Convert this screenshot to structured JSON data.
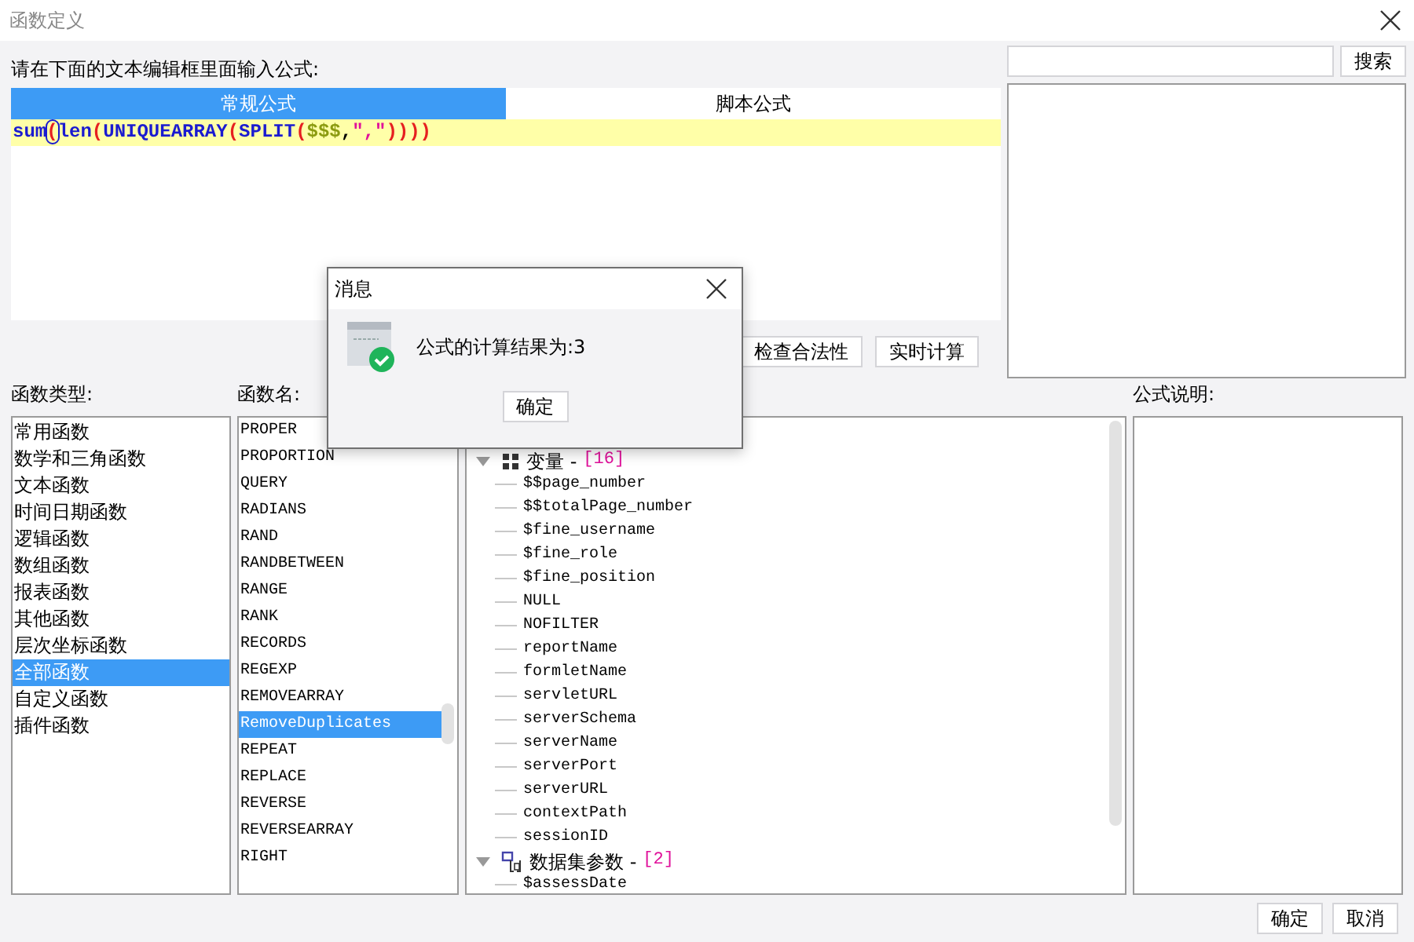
{
  "window": {
    "title": "函数定义"
  },
  "editor": {
    "prompt": "请在下面的文本编辑框里面输入公式:",
    "tabs": [
      {
        "label": "常规公式",
        "selected": true
      },
      {
        "label": "脚本公式",
        "selected": false
      }
    ],
    "formula": [
      {
        "text": "sum",
        "kind": "name"
      },
      {
        "text": "(",
        "kind": "paren",
        "matched": true
      },
      {
        "text": "len",
        "kind": "name"
      },
      {
        "text": "(",
        "kind": "paren",
        "matched": false
      },
      {
        "text": "UNIQUEARRAY",
        "kind": "name"
      },
      {
        "text": "(",
        "kind": "paren",
        "matched": false
      },
      {
        "text": "SPLIT",
        "kind": "name"
      },
      {
        "text": "(",
        "kind": "paren",
        "matched": false
      },
      {
        "text": "$$$",
        "kind": "param"
      },
      {
        "text": ",",
        "kind": "plain"
      },
      {
        "text": "\",\"",
        "kind": "string"
      },
      {
        "text": "))))",
        "kind": "paren",
        "matched": false
      }
    ],
    "buttons": [
      "检查合法性",
      "实时计算"
    ]
  },
  "search": {
    "button": "搜索"
  },
  "function_types": {
    "label": "函数类型:",
    "items": [
      {
        "label": "常用函数",
        "selected": false
      },
      {
        "label": "数学和三角函数",
        "selected": false
      },
      {
        "label": "文本函数",
        "selected": false
      },
      {
        "label": "时间日期函数",
        "selected": false
      },
      {
        "label": "逻辑函数",
        "selected": false
      },
      {
        "label": "数组函数",
        "selected": false
      },
      {
        "label": "报表函数",
        "selected": false
      },
      {
        "label": "其他函数",
        "selected": false
      },
      {
        "label": "层次坐标函数",
        "selected": false
      },
      {
        "label": "全部函数",
        "selected": true
      },
      {
        "label": "自定义函数",
        "selected": false
      },
      {
        "label": "插件函数",
        "selected": false
      }
    ]
  },
  "function_names": {
    "label": "函数名:",
    "items": [
      {
        "label": "PROPER",
        "selected": false
      },
      {
        "label": "PROPORTION",
        "selected": false
      },
      {
        "label": "QUERY",
        "selected": false
      },
      {
        "label": "RADIANS",
        "selected": false
      },
      {
        "label": "RAND",
        "selected": false
      },
      {
        "label": "RANDBETWEEN",
        "selected": false
      },
      {
        "label": "RANGE",
        "selected": false
      },
      {
        "label": "RANK",
        "selected": false
      },
      {
        "label": "RECORDS",
        "selected": false
      },
      {
        "label": "REGEXP",
        "selected": false
      },
      {
        "label": "REMOVEARRAY",
        "selected": false
      },
      {
        "label": "RemoveDuplicates",
        "selected": true
      },
      {
        "label": "REPEAT",
        "selected": false
      },
      {
        "label": "REPLACE",
        "selected": false
      },
      {
        "label": "REVERSE",
        "selected": false
      },
      {
        "label": "REVERSEARRAY",
        "selected": false
      },
      {
        "label": "RIGHT",
        "selected": false
      }
    ]
  },
  "parameter_tree": [
    {
      "label": "变量 -",
      "count": "[16]",
      "kind": "variables",
      "expanded": true,
      "children": [
        {
          "label": "$$page_number"
        },
        {
          "label": "$$totalPage_number"
        },
        {
          "label": "$fine_username"
        },
        {
          "label": "$fine_role"
        },
        {
          "label": "$fine_position"
        },
        {
          "label": "NULL"
        },
        {
          "label": "NOFILTER"
        },
        {
          "label": "reportName"
        },
        {
          "label": "formletName"
        },
        {
          "label": "servletURL"
        },
        {
          "label": "serverSchema"
        },
        {
          "label": "serverName"
        },
        {
          "label": "serverPort"
        },
        {
          "label": "serverURL"
        },
        {
          "label": "contextPath"
        },
        {
          "label": "sessionID"
        }
      ]
    },
    {
      "label": "数据集参数 -",
      "count": "[2]",
      "kind": "dataset",
      "expanded": true,
      "children": [
        {
          "label": "$assessDate"
        }
      ]
    }
  ],
  "description": {
    "label": "公式说明:"
  },
  "footer_buttons": [
    "确定",
    "取消"
  ],
  "message_dialog": {
    "title": "消息",
    "text": "公式的计算结果为:3",
    "button": "确定"
  }
}
